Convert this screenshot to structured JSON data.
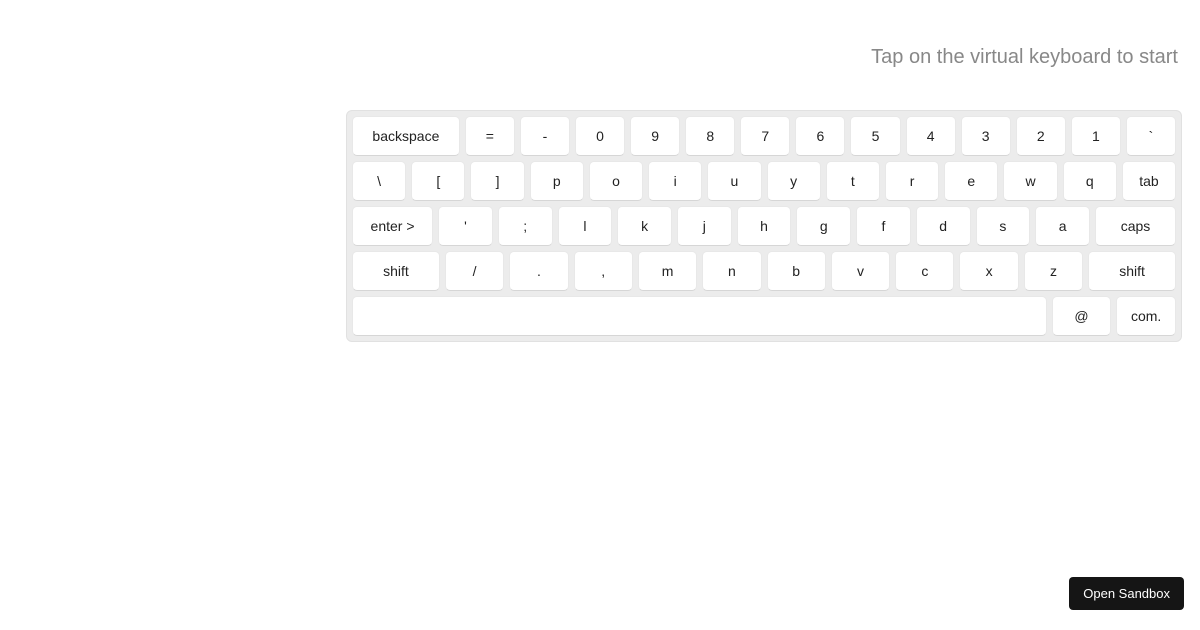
{
  "instruction": "Tap on the virtual keyboard to start",
  "keyboard": {
    "row1": [
      "backspace",
      "=",
      "-",
      "0",
      "9",
      "8",
      "7",
      "6",
      "5",
      "4",
      "3",
      "2",
      "1",
      "`"
    ],
    "row2": [
      "\\",
      "[",
      "]",
      "p",
      "o",
      "i",
      "u",
      "y",
      "t",
      "r",
      "e",
      "w",
      "q",
      "tab"
    ],
    "row3": [
      "enter >",
      "'",
      ";",
      "l",
      "k",
      "j",
      "h",
      "g",
      "f",
      "d",
      "s",
      "a",
      "caps"
    ],
    "row4": [
      "shift",
      "/",
      ".",
      ",",
      "m",
      "n",
      "b",
      "v",
      "c",
      "x",
      "z",
      "shift"
    ],
    "row5": [
      "",
      "@",
      "com."
    ]
  },
  "sandbox_button": "Open Sandbox"
}
